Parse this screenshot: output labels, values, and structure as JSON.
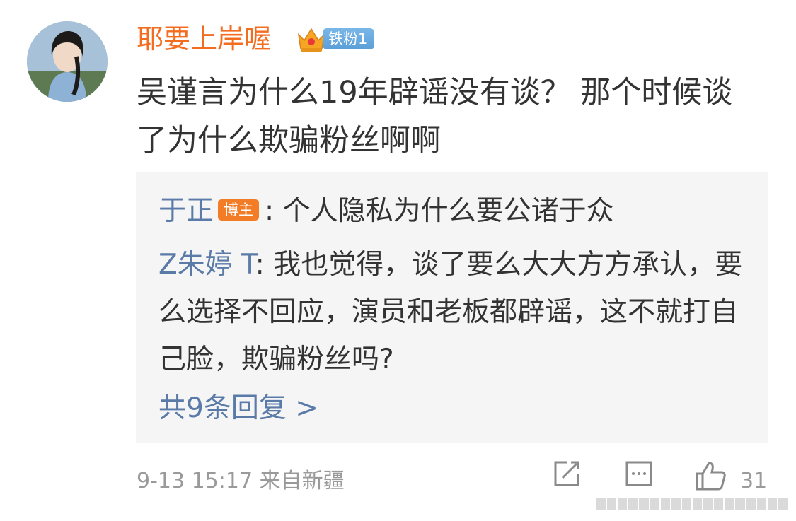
{
  "comment": {
    "username": "耶要上岸喔",
    "fan_badge": "铁粉1",
    "text": "吴谨言为什么19年辟谣没有谈？ 那个时候谈了为什么欺骗粉丝啊啊",
    "meta": "9-13 15:17  来自新疆",
    "like_count": "31"
  },
  "replies": [
    {
      "name": "于正",
      "badge": "博主",
      "sep": ": ",
      "text": "个人隐私为什么要公诸于众"
    },
    {
      "name": "Z朱婷 T",
      "badge": "",
      "sep": ": ",
      "text": "我也觉得，谈了要么大大方方承认，要么选择不回应，演员和老板都辟谣，这不就打自己脸，欺骗粉丝吗?"
    }
  ],
  "reply_count_label": "共9条回复 >",
  "icons": [
    "crown-icon",
    "edit-icon",
    "comment-icon",
    "like-icon"
  ],
  "colors": {
    "username": "#f36d21",
    "link": "#5a7ba8",
    "reply_bg": "#f5f5f5",
    "badge_blue": "#6aaae0",
    "badge_orange": "#f37d27"
  }
}
